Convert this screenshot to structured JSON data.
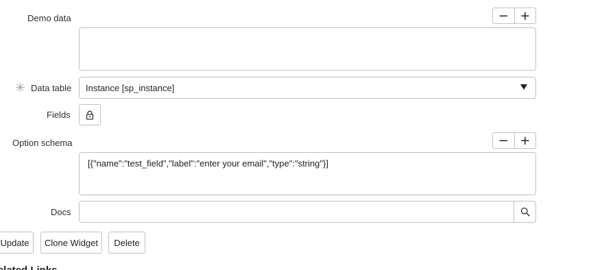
{
  "demo_data": {
    "label": "Demo data",
    "value": "",
    "collapse_label": "−",
    "expand_label": "+"
  },
  "data_table": {
    "label": "Data table",
    "mandatory_glyph": "✳",
    "selected": "Instance [sp_instance]"
  },
  "fields": {
    "label": "Fields"
  },
  "option_schema": {
    "label": "Option schema",
    "value": "[{\"name\":\"test_field\",\"label\":\"enter your email\",\"type\":\"string\"}]",
    "collapse_label": "−",
    "expand_label": "+"
  },
  "docs": {
    "label": "Docs",
    "value": ""
  },
  "actions": {
    "update": "Update",
    "clone_widget": "Clone Widget",
    "delete": "Delete"
  },
  "related_links": {
    "heading": "Related Links"
  },
  "icons": {
    "lock": "lock-icon",
    "search": "search-icon",
    "dropdown": "chevron-down-icon",
    "mandatory": "asterisk-icon"
  }
}
